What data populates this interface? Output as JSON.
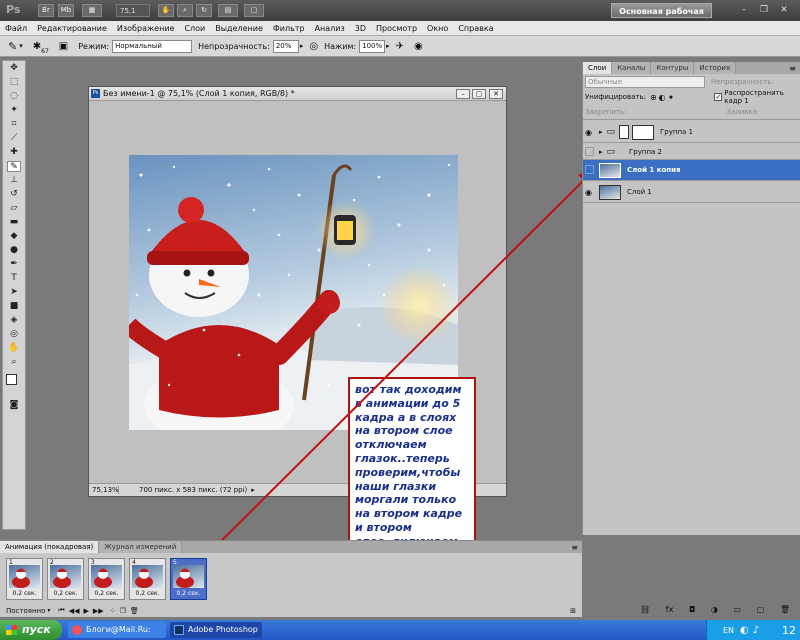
{
  "app": {
    "logo": "Ps",
    "zoom": "75,1",
    "workspace": "Основная рабочая среда"
  },
  "menu": [
    "Файл",
    "Редактирование",
    "Изображение",
    "Слои",
    "Выделение",
    "Фильтр",
    "Анализ",
    "3D",
    "Просмотр",
    "Окно",
    "Справка"
  ],
  "options": {
    "brush_size": "67",
    "mode_label": "Режим:",
    "mode_value": "Нормальный",
    "opacity_label": "Непрозрачность:",
    "opacity_value": "20%",
    "flow_label": "Нажим:",
    "flow_value": "100%"
  },
  "document": {
    "title": "Без имени-1 @ 75,1% (Слой 1 копия, RGB/8) *",
    "zoom": "75,13%",
    "info": "700 пикс. x 583 пикс. (72 ppi)"
  },
  "callout": "вот так доходим в анимации до 5 кадра а в слоях на втором слое отключаем глазок..теперь проверим,чтобы наши глазки моргали только на втором кадре и втором слое..включаем анимацию и смотрим",
  "layers_panel": {
    "tabs": [
      "Слои",
      "Каналы",
      "Контуры",
      "История"
    ],
    "blend_mode": "Обычные",
    "opacity_label": "Непрозрачность:",
    "unify_label": "Унифицировать:",
    "propagate_label": "Распространить кадр 1",
    "lock_label": "Закрепить:",
    "fill_label": "Заливка:",
    "layers": [
      {
        "name": "Группа 1",
        "type": "group",
        "visible": true,
        "selected": false
      },
      {
        "name": "Группа 2",
        "type": "group",
        "visible": false,
        "selected": false
      },
      {
        "name": "Слой 1 копия",
        "type": "layer",
        "visible": false,
        "selected": true
      },
      {
        "name": "Слой 1",
        "type": "layer",
        "visible": true,
        "selected": false
      }
    ]
  },
  "animation_panel": {
    "tabs": [
      "Анимация (покадровая)",
      "Журнал измерений"
    ],
    "loop": "Постоянно",
    "frames": [
      {
        "num": "1",
        "duration": "0,2 сек."
      },
      {
        "num": "2",
        "duration": "0,2 сек."
      },
      {
        "num": "3",
        "duration": "0,2 сек."
      },
      {
        "num": "4",
        "duration": "0,2 сек."
      },
      {
        "num": "5",
        "duration": "0,2 сек."
      }
    ]
  },
  "taskbar": {
    "start": "пуск",
    "tasks": [
      "Блоги@Mail.Ru: Мой ...",
      "Adobe Photoshop CS..."
    ],
    "lang": "EN",
    "clock": "12"
  },
  "colors": {
    "accent_selected": "#3a6fc4",
    "callout_border": "#b01010",
    "callout_text": "#1a2f8a",
    "taskbar": "#2456c6"
  }
}
